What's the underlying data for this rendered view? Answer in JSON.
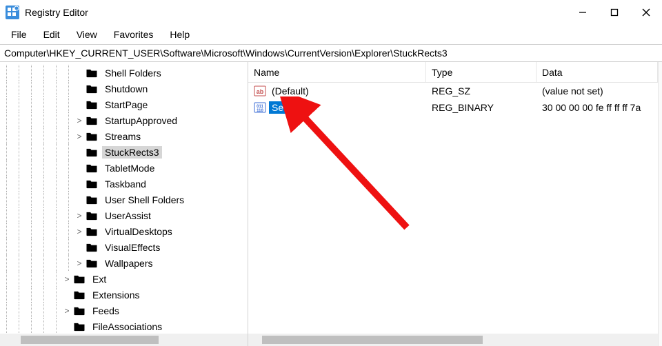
{
  "window": {
    "title": "Registry Editor"
  },
  "menu": {
    "file": "File",
    "edit": "Edit",
    "view": "View",
    "favorites": "Favorites",
    "help": "Help"
  },
  "address": "Computer\\HKEY_CURRENT_USER\\Software\\Microsoft\\Windows\\CurrentVersion\\Explorer\\StuckRects3",
  "tree": {
    "items": [
      {
        "label": "Shell Folders",
        "depth": 6,
        "expand": ""
      },
      {
        "label": "Shutdown",
        "depth": 6,
        "expand": ""
      },
      {
        "label": "StartPage",
        "depth": 6,
        "expand": ""
      },
      {
        "label": "StartupApproved",
        "depth": 6,
        "expand": ">"
      },
      {
        "label": "Streams",
        "depth": 6,
        "expand": ">"
      },
      {
        "label": "StuckRects3",
        "depth": 6,
        "expand": "",
        "selected": true
      },
      {
        "label": "TabletMode",
        "depth": 6,
        "expand": ""
      },
      {
        "label": "Taskband",
        "depth": 6,
        "expand": ""
      },
      {
        "label": "User Shell Folders",
        "depth": 6,
        "expand": ""
      },
      {
        "label": "UserAssist",
        "depth": 6,
        "expand": ">"
      },
      {
        "label": "VirtualDesktops",
        "depth": 6,
        "expand": ">"
      },
      {
        "label": "VisualEffects",
        "depth": 6,
        "expand": ""
      },
      {
        "label": "Wallpapers",
        "depth": 6,
        "expand": ">"
      },
      {
        "label": "Ext",
        "depth": 5,
        "expand": ">"
      },
      {
        "label": "Extensions",
        "depth": 5,
        "expand": ""
      },
      {
        "label": "Feeds",
        "depth": 5,
        "expand": ">"
      },
      {
        "label": "FileAssociations",
        "depth": 5,
        "expand": ""
      }
    ]
  },
  "list": {
    "columns": {
      "name": "Name",
      "type": "Type",
      "data": "Data"
    },
    "rows": [
      {
        "icon": "string",
        "name": "(Default)",
        "type": "REG_SZ",
        "data": "(value not set)"
      },
      {
        "icon": "binary",
        "name": "Settings",
        "type": "REG_BINARY",
        "data": "30 00 00 00 fe ff ff ff 7a",
        "selected": true
      }
    ]
  }
}
